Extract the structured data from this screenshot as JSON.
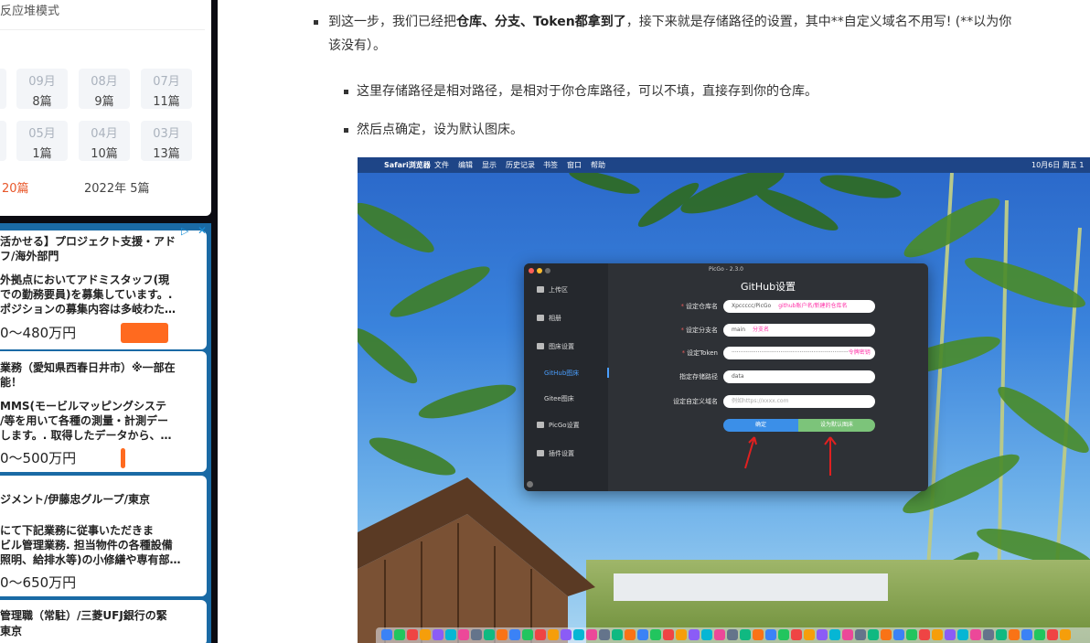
{
  "sidebar": {
    "archive_header": "反应堆模式",
    "months": [
      {
        "month": "09月",
        "count": "8篇"
      },
      {
        "month": "08月",
        "count": "9篇"
      },
      {
        "month": "07月",
        "count": "11篇"
      },
      {
        "month": "05月",
        "count": "1篇"
      },
      {
        "month": "04月",
        "count": "10篇"
      },
      {
        "month": "03月",
        "count": "13篇"
      }
    ],
    "year_left": "20篇",
    "year_right": "2022年  5篇"
  },
  "ads": [
    {
      "title1": "活かせる】プロジェクト支援・アド",
      "title2": "フ/海外部門",
      "desc1": "外拠点においてアドミスタッフ(現",
      "desc2": "での勤務要員)を募集しています。.",
      "desc3": "ポジションの募集内容は多岐わた…",
      "salary": "0～480万円"
    },
    {
      "title1": "業務（愛知県西春日井市）※一部在",
      "title2": "能！",
      "desc1": "MMS(モービルマッピングシステ",
      "desc2": "/等を用いて各種の測量・計測デー",
      "desc3": "します。. 取得したデータから、…",
      "salary": "0～500万円"
    },
    {
      "title1": "ジメント/伊藤忠グループ/東京",
      "title2": "",
      "desc1": "にて下記業務に従事いただきま",
      "desc2": "ビル管理業務. 担当物件の各種設備",
      "desc3": "照明、給排水等)の小修繕や専有部…",
      "salary": "0～650万円"
    },
    {
      "title1": "管理職（常駐）/三菱UFJ銀行の緊",
      "title2": "東京",
      "desc1": "",
      "desc2": "",
      "desc3": "",
      "salary": ""
    }
  ],
  "ad_choice": "▷",
  "ad_close": "✕",
  "article": {
    "p1_a": "到这一步，我们已经把",
    "p1_b": "仓库、分支、Token都拿到了",
    "p1_c": "，接下来就是存储路径的设置，其中**自定义域名不用写! (**以为你",
    "p1_d": "该没有）。",
    "p2": "这里存储路径是相对路径，是相对于你仓库路径，可以不填，直接存到你的仓库。",
    "p3": "然后点确定，设为默认图床。"
  },
  "screenshot": {
    "menubar": [
      "Safari浏览器",
      "文件",
      "编辑",
      "显示",
      "历史记录",
      "书签",
      "窗口",
      "帮助"
    ],
    "menubar_right": "10月6日 周五 1",
    "picgo": {
      "window_title": "PicGo - 2.3.0",
      "nav": [
        "上传区",
        "相册",
        "图床设置",
        "GitHub图床",
        "Gitee图床",
        "PicGo设置",
        "插件设置"
      ],
      "heading": "GitHub设置",
      "fields": [
        {
          "label": "设定仓库名",
          "required": true,
          "value": "Xpccccc/PicGo",
          "hint": "github账户名/新建的仓库名"
        },
        {
          "label": "设定分支名",
          "required": true,
          "value": "main",
          "hint": "分支名"
        },
        {
          "label": "设定Token",
          "required": true,
          "value": "···································································",
          "hint": "令牌密钥"
        },
        {
          "label": "指定存储路径",
          "required": false,
          "value": "data",
          "hint": ""
        },
        {
          "label": "设定自定义域名",
          "required": false,
          "value": "例如https://xxxx.com",
          "hint": ""
        }
      ],
      "confirm_label": "确定",
      "default_label": "设为默认图床"
    }
  },
  "colors": {
    "accent_orange": "#e8572a",
    "ad_blue": "#1a6aa5",
    "picgo_blue": "#3b8fe8",
    "picgo_green": "#7cc47a",
    "hint_pink": "#ff2fa6"
  }
}
